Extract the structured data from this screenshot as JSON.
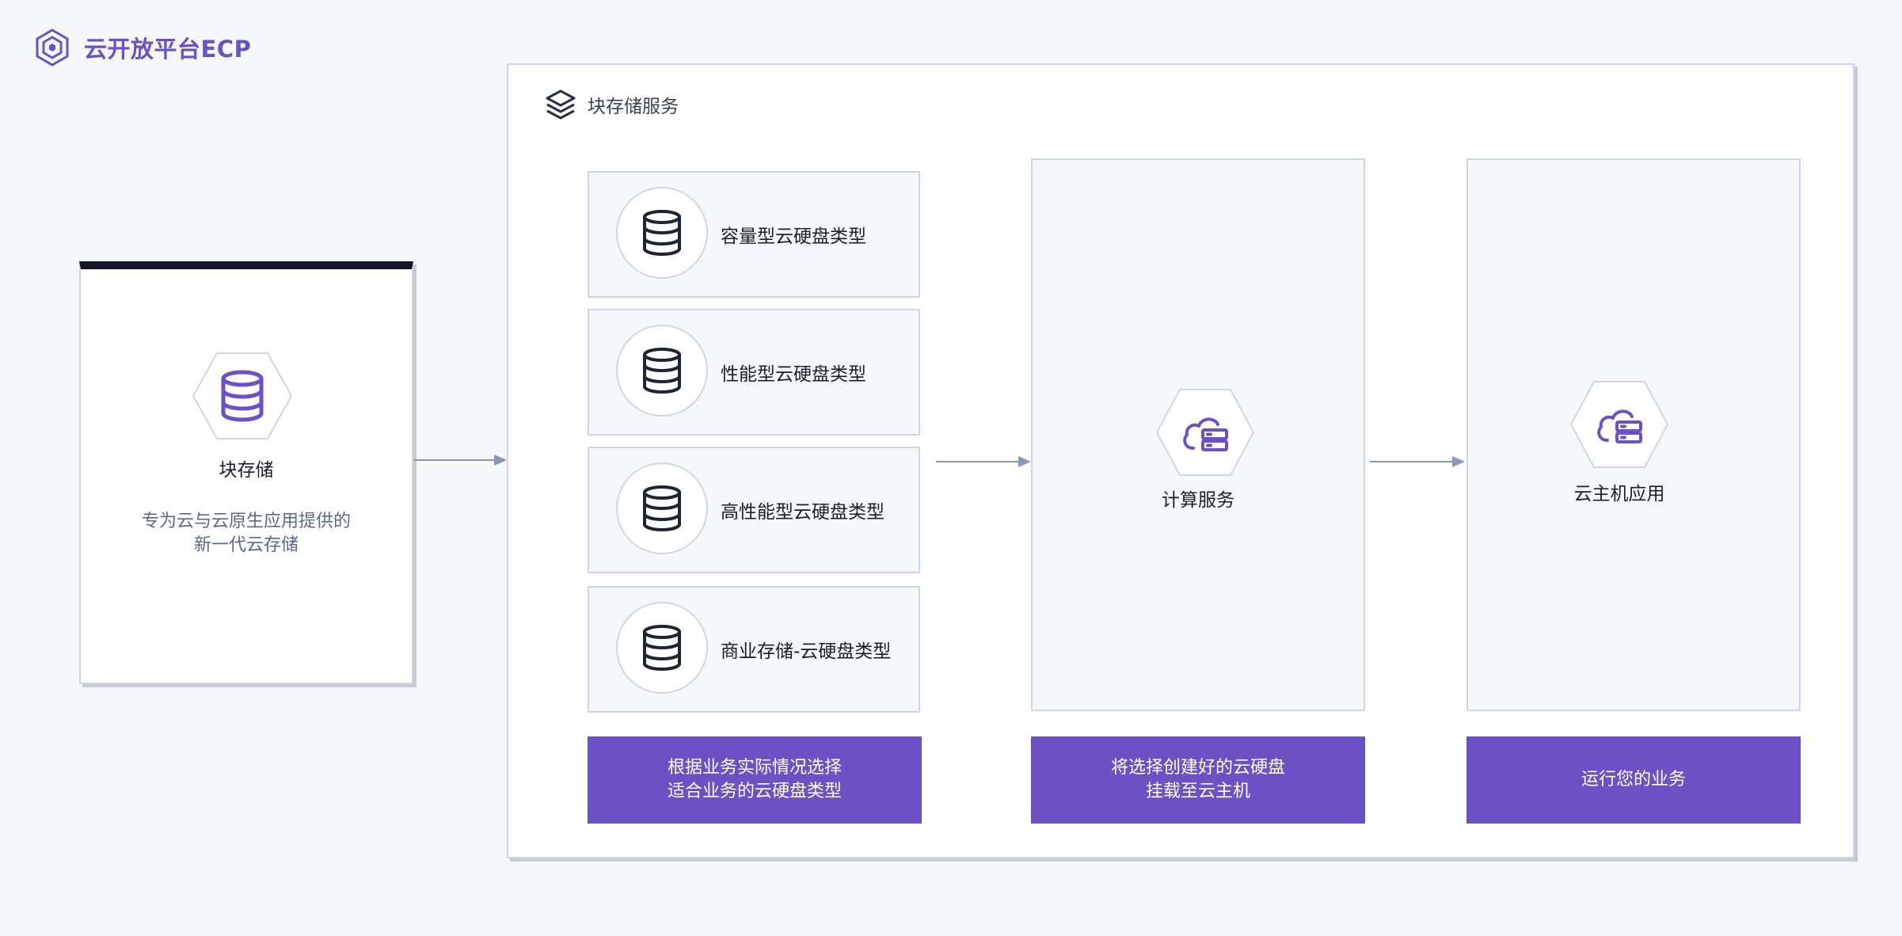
{
  "brand": {
    "title": "云开放平台ECP",
    "icon": "hexagon-logo-icon"
  },
  "block_storage": {
    "title": "块存储",
    "description_line1": "专为云与云原生应用提供的",
    "description_line2": "新一代云存储",
    "icon": "database-icon"
  },
  "panel": {
    "title": "块存储服务",
    "icon": "layers-icon",
    "types": [
      {
        "label": "容量型云硬盘类型",
        "icon": "database-icon"
      },
      {
        "label": "性能型云硬盘类型",
        "icon": "database-icon"
      },
      {
        "label": "高性能型云硬盘类型",
        "icon": "database-icon"
      },
      {
        "label": "商业存储-云硬盘类型",
        "icon": "database-icon"
      }
    ],
    "compute": {
      "label": "计算服务",
      "icon": "cloud-server-icon"
    },
    "host": {
      "label": "云主机应用",
      "icon": "cloud-server-icon"
    },
    "steps": [
      {
        "line1": "根据业务实际情况选择",
        "line2": "适合业务的云硬盘类型"
      },
      {
        "line1": "将选择创建好的云硬盘",
        "line2": "挂载至云主机"
      },
      {
        "line1": "运行您的业务",
        "line2": ""
      }
    ]
  },
  "colors": {
    "accent": "#6b52c4",
    "border": "#cfd5e2",
    "arrow": "#8a97b4",
    "dark": "#141628"
  }
}
